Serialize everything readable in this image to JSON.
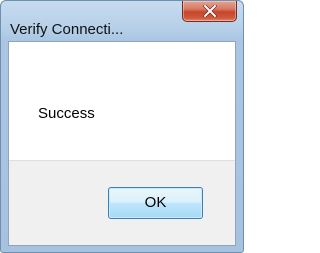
{
  "window": {
    "title": "Verify Connecti..."
  },
  "titlebar": {
    "close_icon": "close-x-icon"
  },
  "dialog": {
    "message": "Success",
    "ok_label": "OK"
  },
  "colors": {
    "frame": "#b6cfe8",
    "close_button": "#c6452c",
    "ok_button_border": "#3c7fb1",
    "footer_background": "#f0f0f0"
  }
}
